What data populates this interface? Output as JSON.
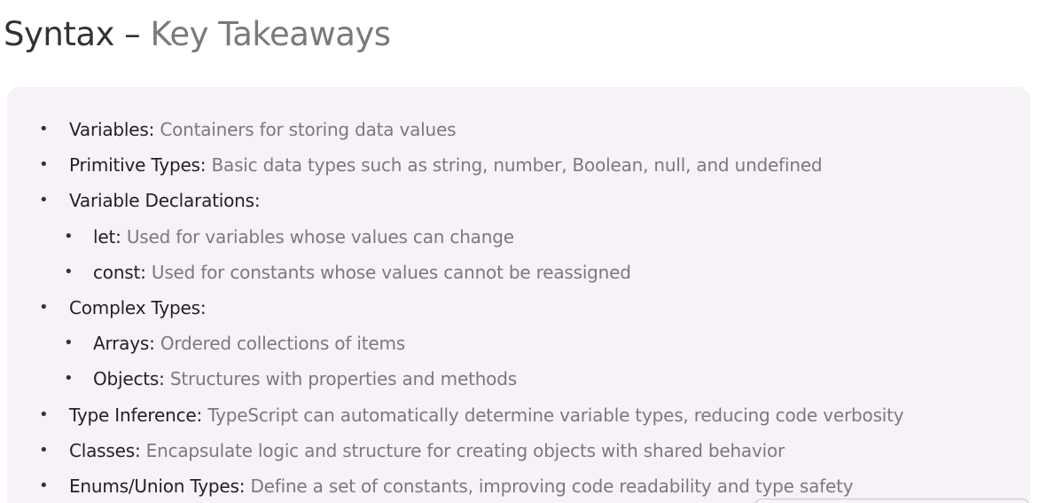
{
  "title": {
    "main": "Syntax –",
    "accent": "Key Takeaways"
  },
  "items": [
    {
      "term": "Variables:",
      "desc": "Containers for storing data values"
    },
    {
      "term": "Primitive Types:",
      "desc": "Basic data types such as string, number, Boolean, null, and undefined"
    },
    {
      "term": "Variable Declarations:",
      "desc": ""
    },
    {
      "term": "let:",
      "desc": "Used for variables whose values can change"
    },
    {
      "term": "const:",
      "desc": "Used for constants whose values cannot be reassigned"
    },
    {
      "term": "Complex Types:",
      "desc": ""
    },
    {
      "term": "Arrays:",
      "desc": "Ordered collections of items"
    },
    {
      "term": "Objects:",
      "desc": "Structures with properties and methods"
    },
    {
      "term": "Type Inference:",
      "desc": "TypeScript can automatically determine variable types, reducing code verbosity"
    },
    {
      "term": "Classes:",
      "desc": "Encapsulate logic and structure for creating objects with shared behavior"
    },
    {
      "term": "Enums/Union Types:",
      "desc": "Define a set of constants, improving code readability and type safety"
    }
  ],
  "bullet_glyph": "•"
}
